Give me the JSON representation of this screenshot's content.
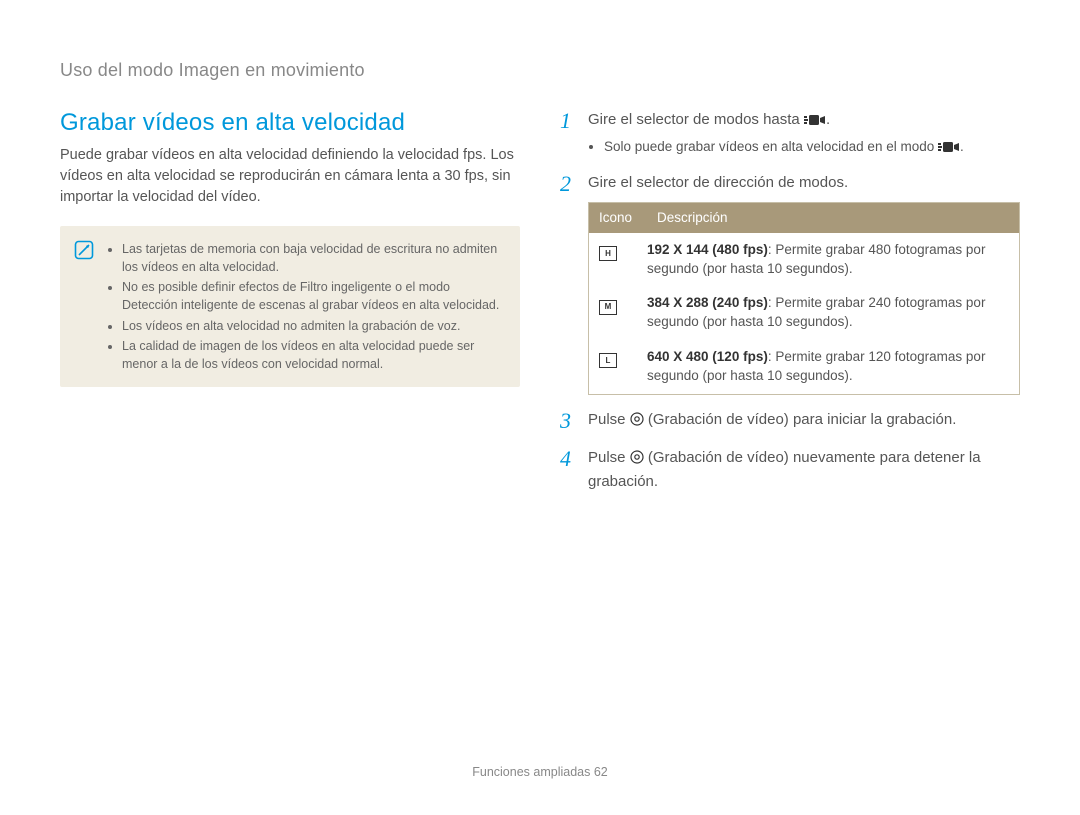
{
  "breadcrumb": "Uso del modo Imagen en movimiento",
  "left": {
    "title": "Grabar vídeos en alta velocidad",
    "intro": "Puede grabar vídeos en alta velocidad definiendo la velocidad fps. Los vídeos en alta velocidad se reproducirán en cámara lenta a 30 fps, sin importar la velocidad del vídeo.",
    "notes": [
      "Las tarjetas de memoria con baja velocidad de escritura no admiten los vídeos en alta velocidad.",
      "No es posible definir efectos de Filtro ingeligente o el modo Detección inteligente de escenas al grabar vídeos en alta velocidad.",
      "Los vídeos en alta velocidad no admiten la grabación de voz.",
      "La calidad de imagen de los vídeos en alta velocidad puede ser menor a la de los vídeos con velocidad normal."
    ]
  },
  "steps": {
    "s1": {
      "num": "1",
      "text_a": "Gire el selector de modos hasta ",
      "text_b": ".",
      "bullet_a": "Solo puede grabar vídeos en alta velocidad en el modo ",
      "bullet_b": "."
    },
    "s2": {
      "num": "2",
      "text": "Gire el selector de dirección de modos."
    },
    "s3": {
      "num": "3",
      "text_a": "Pulse ",
      "text_b": " (Grabación de vídeo) para iniciar la grabación."
    },
    "s4": {
      "num": "4",
      "text_a": "Pulse ",
      "text_b": " (Grabación de vídeo) nuevamente para detener la grabación."
    }
  },
  "table": {
    "header_icon": "Icono",
    "header_desc": "Descripción",
    "rows": [
      {
        "icon": "H",
        "bold": "192 X 144 (480 fps)",
        "rest": ": Permite grabar 480 fotogramas por segundo (por hasta 10 segundos)."
      },
      {
        "icon": "M",
        "bold": "384 X 288 (240 fps)",
        "rest": ": Permite grabar 240 fotogramas por segundo (por hasta 10 segundos)."
      },
      {
        "icon": "L",
        "bold": "640 X 480 (120 fps)",
        "rest": ": Permite grabar 120 fotogramas por segundo (por hasta 10 segundos)."
      }
    ]
  },
  "footer": {
    "text": "Funciones ampliadas  ",
    "page": "62"
  }
}
